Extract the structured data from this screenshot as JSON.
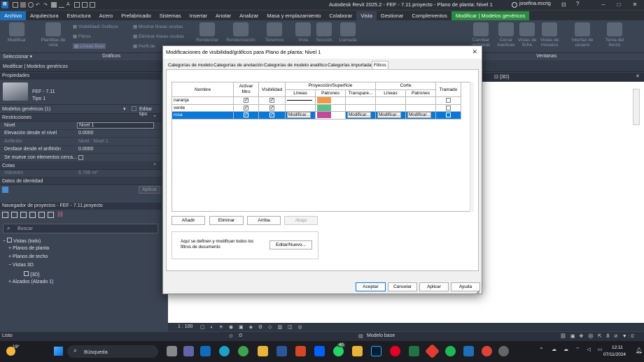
{
  "app": {
    "title": "Autodesk Revit 2025.2 - FEF - 7.11.proyecto - Plano de planta: Nivel 1",
    "user": "josefina.escrig"
  },
  "menu": {
    "tabs": [
      "Archivo",
      "Arquitectura",
      "Estructura",
      "Acero",
      "Prefabricado",
      "Sistemas",
      "Insertar",
      "Anotar",
      "Analizar",
      "Masa y emplazamiento",
      "Colaborar",
      "Vista",
      "Gestionar",
      "Complementos",
      "Modificar | Modelos genéricos"
    ]
  },
  "ribbon": {
    "modify": "Modificar",
    "templates": "Plantillas de vista",
    "vis_graphics": "Visibilidad/ Gráficos",
    "filters": "Filtros",
    "thin_lines": "Líneas finas",
    "show_hidden": "Mostrar líneas ocultas",
    "remove_hidden": "Eliminar líneas ocultas",
    "cut_profile": "Perfil de",
    "render": "Renderizar",
    "render_cloud": "Renderización",
    "sheet": "Tenemos",
    "view": "Vista",
    "section": "Sección",
    "callout": "Llamada",
    "switch": "Cambiar ventanas",
    "close": "Cerrar inactivas",
    "tab_views": "Vistas de ficha",
    "tile": "Vistas de mosaico",
    "ui": "Interfaz de usuario",
    "canvas": "Tema del lienzo",
    "panel_select": "Seleccionar ▾",
    "panel_graphics": "Gráficos",
    "panel_windows": "Ventanas"
  },
  "context_bar": "Modificar | Modelos genéricos",
  "properties": {
    "title": "Propiedades",
    "family": "FEF - 7.11",
    "type": "Tipo 1",
    "selector": "Modelos genéricos (1)",
    "edit_type": "Editar tipo",
    "sections": {
      "constraints": "Restricciones",
      "dimensions": "Cotas",
      "identity": "Datos de identidad"
    },
    "rows": [
      {
        "k": "Nivel",
        "v": "Nivel 1"
      },
      {
        "k": "Elevación desde el nivel",
        "v": "0.0000"
      },
      {
        "k": "Anfitrión",
        "v": "Nivel : Nivel 1"
      },
      {
        "k": "Desfase desde el anfitrión",
        "v": "0.0000"
      },
      {
        "k": "Se mueve con elementos cerca...",
        "v": ""
      }
    ],
    "volume_k": "Volumen",
    "volume_v": "6.786 m³",
    "apply": "Aplicar"
  },
  "browser": {
    "title": "Navegador de proyectos - FEF - 7.11.proyecto",
    "search": "Buscar",
    "root": "Vistas (todo)",
    "items": [
      "Planos de planta",
      "Planos de techo",
      "Vistas 3D",
      "{3D}",
      "Alzados (Alzado 1)"
    ]
  },
  "view_tab": "{3D}",
  "view_scale": "1 : 100",
  "status": {
    "left": "Listo",
    "model": "Modelo base",
    "count": ":0"
  },
  "dialog": {
    "title": "Modificaciones de visibilidad/gráficos para Plano de planta: Nivel 1",
    "tabs": [
      "Categorías de modelo",
      "Categorías de anotación",
      "Categorías de modelo analítico",
      "Categorías importadas",
      "Filtros"
    ],
    "headers": {
      "name": "Nombre",
      "enable": "Activar filtro",
      "visibility": "Visibilidad",
      "projection": "Proyección/Superficie",
      "cut": "Corte",
      "halftone": "Tramado",
      "lines": "Líneas",
      "patterns": "Patrones",
      "transparency": "Transpare..."
    },
    "rows": [
      {
        "name": "naranja",
        "color": "#ef9a4a"
      },
      {
        "name": "verde",
        "color": "#5cc08a"
      },
      {
        "name": "rosa",
        "color": "#c14b9b"
      }
    ],
    "modify_label": "Modificar...",
    "add": "Añadir",
    "remove": "Eliminar",
    "up": "Arriba",
    "down": "Abajo",
    "note": "Aquí se definen y modifican todos los filtros de documento",
    "edit_new": "Editar/Nuevo...",
    "ok": "Aceptar",
    "cancel": "Cancelar",
    "apply": "Aplicar",
    "help": "Ayuda"
  },
  "taskbar": {
    "weather": "19°",
    "search": "Búsqueda",
    "time": "12:11",
    "date": "07/11/2024",
    "badge": "40"
  }
}
